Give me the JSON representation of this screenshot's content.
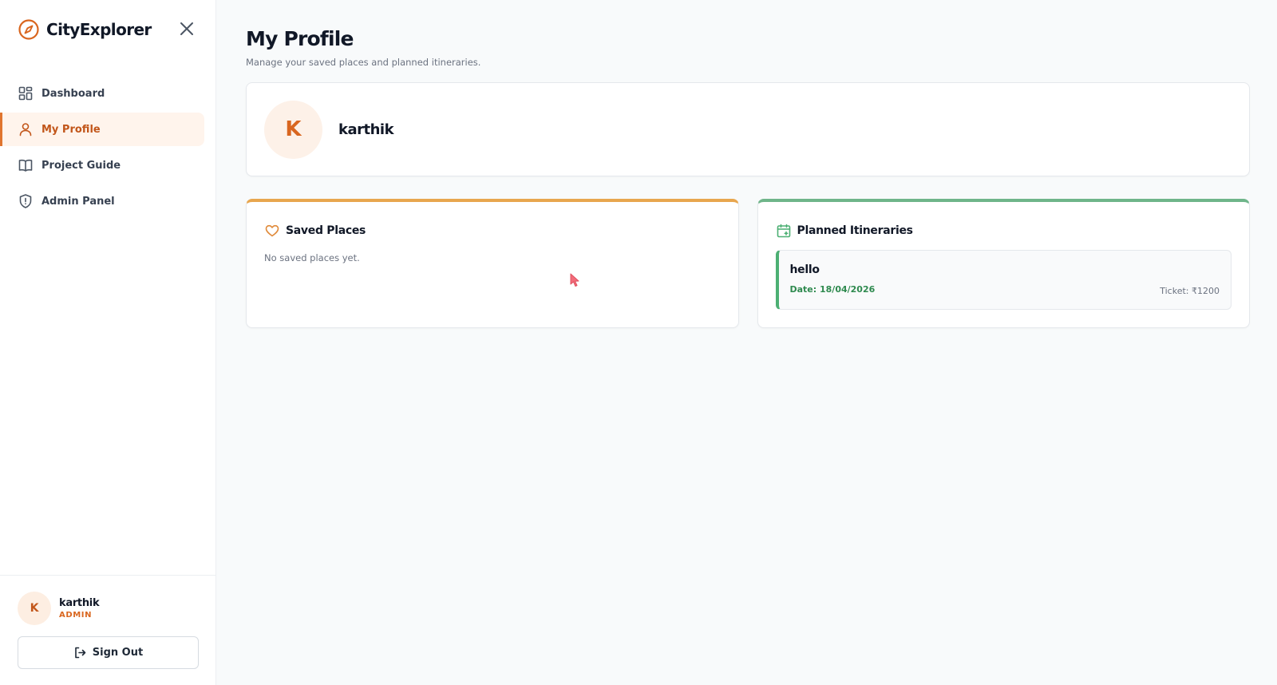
{
  "brand": {
    "name": "CityExplorer",
    "icon": "compass-icon",
    "accent": "#d9661f"
  },
  "sidebar": {
    "items": [
      {
        "label": "Dashboard",
        "icon": "grid-icon",
        "active": false
      },
      {
        "label": "My Profile",
        "icon": "user-icon",
        "active": true
      },
      {
        "label": "Project Guide",
        "icon": "book-icon",
        "active": false
      },
      {
        "label": "Admin Panel",
        "icon": "shield-icon",
        "active": false
      }
    ],
    "user": {
      "initial": "K",
      "name": "karthik",
      "role": "ADMIN"
    },
    "signout_label": "Sign Out"
  },
  "main": {
    "title": "My Profile",
    "subtitle": "Manage your saved places and planned itineraries.",
    "profile": {
      "initial": "K",
      "name": "karthik"
    },
    "saved": {
      "title": "Saved Places",
      "icon": "heart-icon",
      "empty_text": "No saved places yet.",
      "accent": "#e8a64e"
    },
    "itineraries": {
      "title": "Planned Itineraries",
      "icon": "calendar-icon",
      "accent": "#6fb58a",
      "items": [
        {
          "name": "hello",
          "date": "Date: 18/04/2026",
          "ticket": "Ticket: ₹1200"
        }
      ]
    }
  }
}
